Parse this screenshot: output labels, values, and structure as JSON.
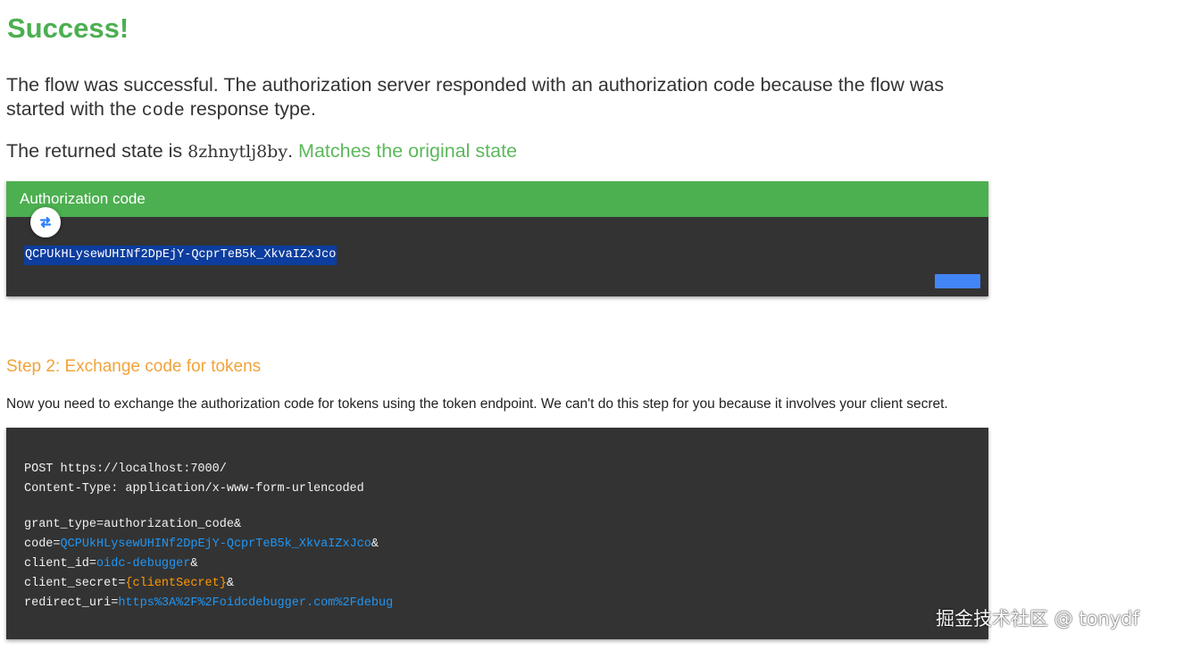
{
  "page": {
    "title": "Success!",
    "intro_before": "The flow was successful. The authorization server responded with an authorization code because the flow was started with the ",
    "intro_code": "code",
    "intro_after": " response type.",
    "state_prefix": "The returned state is ",
    "state_value": "8zhnytlj8by",
    "state_dot": ". ",
    "state_match": "Matches the original state"
  },
  "auth_card": {
    "header": "Authorization code",
    "code": "QCPUkHLysewUHINf2DpEjY-QcprTeB5k_XkvaIZxJco",
    "swap_icon": "swap-arrows-icon"
  },
  "step2": {
    "title": "Step 2: Exchange code for tokens",
    "description": "Now you need to exchange the authorization code for tokens using the token endpoint. We can't do this step for you because it involves your client secret."
  },
  "request": {
    "line1": "POST https://localhost:7000/",
    "line2": "Content-Type: application/x-www-form-urlencoded",
    "grant_type": "grant_type=authorization_code&",
    "code_key": "code=",
    "code_val": "QCPUkHLysewUHINf2DpEjY-QcprTeB5k_XkvaIZxJco",
    "amp": "&",
    "client_id_key": "client_id=",
    "client_id_val": "oidc-debugger",
    "client_secret_key": "client_secret=",
    "client_secret_val": "{clientSecret}",
    "redirect_key": "redirect_uri=",
    "redirect_val": "https%3A%2F%2Foidcdebugger.com%2Fdebug"
  },
  "watermark": "掘金技术社区 @ tonydf",
  "colors": {
    "success_green": "#4caf50",
    "step_orange": "#f0a33a",
    "code_bg": "#333333",
    "link_blue": "#2196f3",
    "secret_orange": "#ff9800",
    "copy_button": "#4285f4"
  }
}
